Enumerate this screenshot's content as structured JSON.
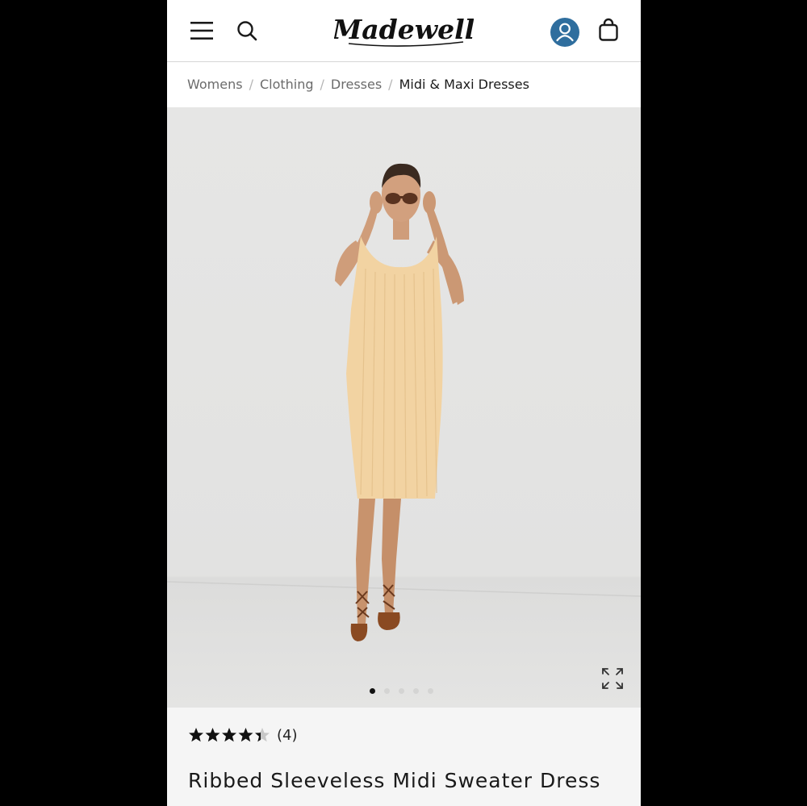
{
  "header": {
    "brand": "Madewell",
    "icons": [
      "hamburger-menu-icon",
      "search-icon",
      "account-icon",
      "shopping-bag-icon"
    ],
    "account_color": "#2f6e9e"
  },
  "breadcrumb": [
    {
      "label": "Womens"
    },
    {
      "label": "Clothing"
    },
    {
      "label": "Dresses"
    },
    {
      "label": "Midi & Maxi Dresses"
    }
  ],
  "breadcrumb_separator": "/",
  "gallery": {
    "image_count": 5,
    "active_index": 0
  },
  "product": {
    "rating": 4.5,
    "review_count": "(4)",
    "title": "Ribbed Sleeveless Midi Sweater Dress"
  }
}
